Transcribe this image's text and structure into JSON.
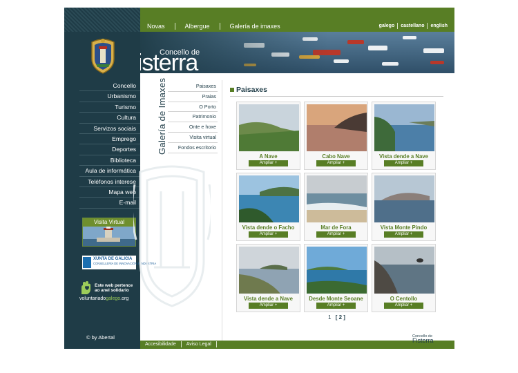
{
  "site": {
    "logo_small": "Concello de",
    "logo_big": "Fisterra",
    "copyright": "© by Abertal"
  },
  "top_nav": [
    "Novas",
    "Albergue",
    "Galería de imaxes"
  ],
  "languages": [
    "galego",
    "castellano",
    "english"
  ],
  "main_nav": [
    "Concello",
    "Urbanismo",
    "Turismo",
    "Cultura",
    "Servizos sociais",
    "Emprego",
    "Deportes",
    "Biblioteca",
    "Aula de informática",
    "Teléfonos interese",
    "Mapa web",
    "E-mail"
  ],
  "gallery_label": "Galería de Imaxes",
  "sub_nav": [
    "Paisaxes",
    "Praias",
    "O Porto",
    "Patrimonio",
    "Onte e hoxe",
    "Visita virtual",
    "Fondos escritorio"
  ],
  "promo": {
    "virtual_visit": "Visita Virtual",
    "xunta_title": "XUNTA DE GALICIA",
    "xunta_sub": "CONSELLERÍA DE INNOVACIÓN E INDUSTRIA",
    "volunteer_text": "Este web pertence ao anel solidario",
    "volunteer_domain_a": "voluntariado",
    "volunteer_domain_b": "galego",
    "volunteer_domain_c": ".org"
  },
  "section_title": "Paisaxes",
  "enlarge_label": "Ampliar +",
  "gallery": [
    {
      "title": "A Nave"
    },
    {
      "title": "Cabo Nave"
    },
    {
      "title": "Vista dende a Nave"
    },
    {
      "title": "Vista dende o Facho"
    },
    {
      "title": "Mar de Fora"
    },
    {
      "title": "Vista Monte Pindo"
    },
    {
      "title": "Vista dende a Nave"
    },
    {
      "title": "Desde Monte Seoane"
    },
    {
      "title": "O Centollo"
    }
  ],
  "pagination": {
    "page_1": "1",
    "current": "[ 2 ]"
  },
  "footer_links": [
    "Accesibilidade",
    "Aviso Legal"
  ],
  "footer_logo_small": "Concello de",
  "footer_logo_big": "Fisterra",
  "colors": {
    "dark_teal": "#1f3c47",
    "green": "#587e25",
    "accent_text": "#587e25"
  }
}
